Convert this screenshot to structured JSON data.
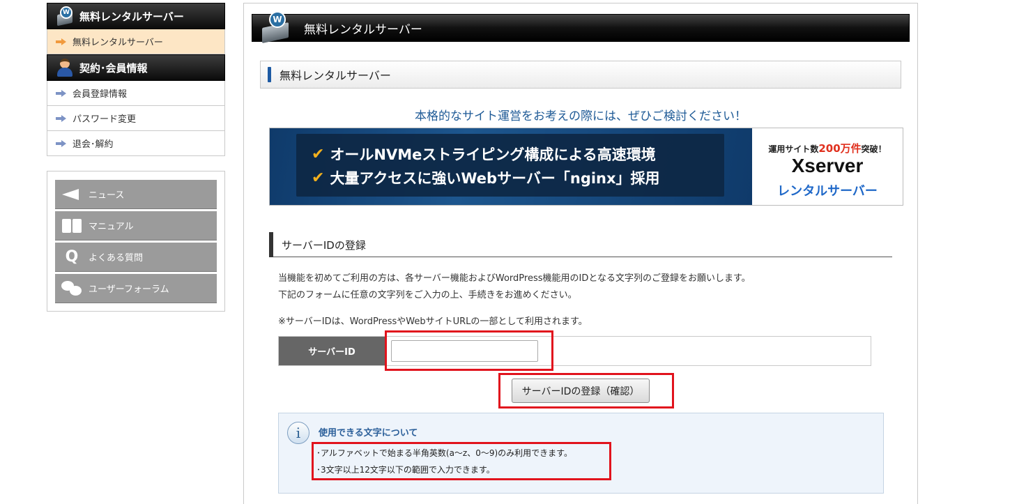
{
  "sidebar": {
    "section1_title": "無料レンタルサーバー",
    "section1_items": [
      "無料レンタルサーバー"
    ],
    "section2_title": "契約･会員情報",
    "section2_items": [
      "会員登録情報",
      "パスワード変更",
      "退会･解約"
    ],
    "buttons": [
      {
        "label": "ニュース",
        "icon": "megaphone-icon"
      },
      {
        "label": "マニュアル",
        "icon": "book-icon"
      },
      {
        "label": "よくある質問",
        "icon": "question-icon"
      },
      {
        "label": "ユーザーフォーラム",
        "icon": "chat-bubbles-icon"
      }
    ]
  },
  "main": {
    "header_title": "無料レンタルサーバー",
    "section_title": "無料レンタルサーバー",
    "lead": "本格的なサイト運営をお考えの際には、ぜひご検討ください！",
    "banner": {
      "line1": "オールNVMeストライピング構成による高速環境",
      "line2": "大量アクセスに強いWebサーバー「nginx」採用",
      "badge_prefix": "運用サイト数",
      "badge_number": "200万件",
      "badge_suffix": "突破！",
      "brand": "Xserver",
      "brand_sub": "レンタルサーバー"
    },
    "registration_heading": "サーバーIDの登録",
    "desc_line1": "当機能を初めてご利用の方は、各サーバー機能およびWordPress機能用のIDとなる文字列のご登録をお願いします。",
    "desc_line2": "下記のフォームに任意の文字列をご入力の上、手続きをお進めください。",
    "note": "※サーバーIDは、WordPressやWebサイトURLの一部として利用されます。",
    "form": {
      "label": "サーバーID",
      "value": "",
      "placeholder": ""
    },
    "submit_label": "サーバーIDの登録（確認）",
    "info": {
      "title": "使用できる文字について",
      "rule1": "･アルファベットで始まる半角英数(a～z、0～9)のみ利用できます。",
      "rule2": "･3文字以上12文字以下の範囲で入力できます。"
    }
  },
  "colors": {
    "accent_blue": "#1e5a96",
    "highlight_red": "#e1131d",
    "active_bg": "#fde6c5",
    "arrow_orange": "#f19a3e"
  }
}
